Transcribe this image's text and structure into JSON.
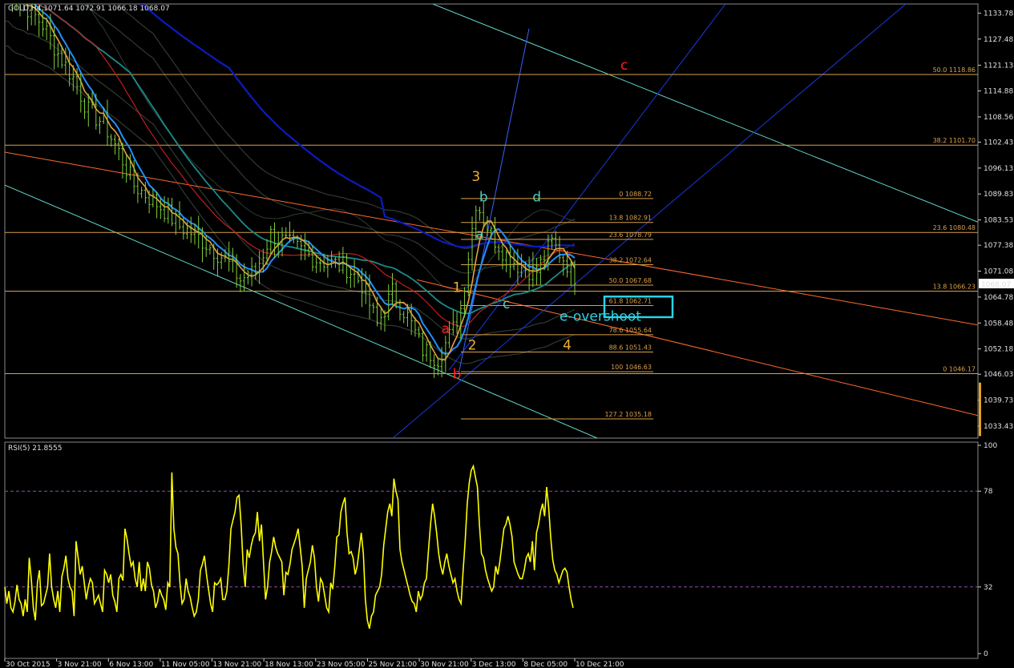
{
  "header": {
    "symbol_label": "GOLD,H4",
    "ohlc_label": "1071.64 1072.91 1066.18 1068.07",
    "current_price_label": "1068.07",
    "rsi_label": "RSI(5) 21.8555"
  },
  "colors": {
    "background": "#000000",
    "candle": "#7fd13b",
    "ma_orange": "#e8a040",
    "ma_blue": "#1e90ff",
    "ma_red": "#d02020",
    "ma_teal": "#1a8a8a",
    "ma_navy": "#0a1cc0",
    "band_gray": "#2f3a35",
    "fib_line": "#d9a04a",
    "channel_orange": "#ff6a2a",
    "channel_aqua": "#5fd7c8",
    "channel_blue": "#1838e0",
    "rsi_line": "#ffff00",
    "rsi_level": "#8a4fa8",
    "price_tag_bg": "#ffffff",
    "highlight_box": "#29d3e6"
  },
  "annotations": {
    "overshoot_label": "e-overshoot"
  },
  "chart_data": [
    {
      "type": "candlestick",
      "title": "GOLD,H4",
      "ylim": [
        1030.5,
        1136
      ],
      "y_ticks": [
        "1133.78",
        "1127.48",
        "1121.13",
        "1114.88",
        "1108.56",
        "1102.43",
        "1096.13",
        "1089.83",
        "1083.53",
        "1077.38",
        "1071.08",
        "1064.78",
        "1058.48",
        "1052.18",
        "1046.03",
        "1039.73",
        "1033.43"
      ],
      "x_ticks": [
        "30 Oct 2015",
        "3 Nov 21:00",
        "6 Nov 13:00",
        "11 Nov 05:00",
        "13 Nov 21:00",
        "18 Nov 13:00",
        "23 Nov 05:00",
        "25 Nov 21:00",
        "30 Nov 21:00",
        "3 Dec 13:00",
        "8 Dec 05:00",
        "10 Dec 21:00"
      ],
      "last_price": 1068.07,
      "price_path": [
        [
          0,
          1140
        ],
        [
          5,
          1136
        ],
        [
          10,
          1131
        ],
        [
          14,
          1124
        ],
        [
          18,
          1118
        ],
        [
          22,
          1110
        ],
        [
          26,
          1107
        ],
        [
          30,
          1100
        ],
        [
          34,
          1092
        ],
        [
          38,
          1089
        ],
        [
          42,
          1086
        ],
        [
          46,
          1082
        ],
        [
          50,
          1080
        ],
        [
          54,
          1077
        ],
        [
          58,
          1074
        ],
        [
          62,
          1069
        ],
        [
          66,
          1071
        ],
        [
          70,
          1080
        ],
        [
          74,
          1078
        ],
        [
          78,
          1076
        ],
        [
          82,
          1074
        ],
        [
          86,
          1073
        ],
        [
          90,
          1072
        ],
        [
          94,
          1068
        ],
        [
          98,
          1058
        ],
        [
          102,
          1066
        ],
        [
          106,
          1060
        ],
        [
          110,
          1052
        ],
        [
          114,
          1050
        ],
        [
          118,
          1057
        ],
        [
          120,
          1062
        ],
        [
          124,
          1088
        ],
        [
          128,
          1080
        ],
        [
          132,
          1075
        ],
        [
          136,
          1072
        ],
        [
          140,
          1071
        ],
        [
          144,
          1078
        ],
        [
          148,
          1073
        ],
        [
          150,
          1068
        ]
      ],
      "fibonacci_retracement_1": [
        {
          "label": "0 1088.72",
          "value": 1088.72
        },
        {
          "label": "13.8 1082.91",
          "value": 1082.91
        },
        {
          "label": "23.6 1078.79",
          "value": 1078.79
        },
        {
          "label": "38.2 1072.64",
          "value": 1072.64
        },
        {
          "label": "50.0 1067.68",
          "value": 1067.68
        },
        {
          "label": "61.8 1062.71",
          "value": 1062.71
        },
        {
          "label": "78.6 1055.64",
          "value": 1055.64
        },
        {
          "label": "88.6 1051.43",
          "value": 1051.43
        },
        {
          "label": "100 1046.63",
          "value": 1046.63
        },
        {
          "label": "127.2 1035.18",
          "value": 1035.18
        }
      ],
      "fibonacci_retracement_2": [
        {
          "label": "0 1046.17",
          "value": 1046.17
        },
        {
          "label": "13.8 1066.23",
          "value": 1066.23
        },
        {
          "label": "23.6 1080.48",
          "value": 1080.48
        },
        {
          "label": "38.2 1101.70",
          "value": 1101.7
        },
        {
          "label": "50.0 1118.86",
          "value": 1118.86
        }
      ],
      "wave_labels": [
        {
          "text": "3",
          "color": "#f0b030",
          "x": 124,
          "y": 1093
        },
        {
          "text": "b",
          "color": "#4fd0c0",
          "x": 126,
          "y": 1088
        },
        {
          "text": "d",
          "color": "#4fd0c0",
          "x": 140,
          "y": 1088
        },
        {
          "text": "a",
          "color": "#4fd0c0",
          "x": 125,
          "y": 1079
        },
        {
          "text": "1",
          "color": "#f0b030",
          "x": 119,
          "y": 1066
        },
        {
          "text": "c",
          "color": "#4fd0c0",
          "x": 132,
          "y": 1062
        },
        {
          "text": "a",
          "color": "#ff2020",
          "x": 116,
          "y": 1056
        },
        {
          "text": "2",
          "color": "#f0b030",
          "x": 123,
          "y": 1052
        },
        {
          "text": "4",
          "color": "#f0b030",
          "x": 148,
          "y": 1052
        },
        {
          "text": "b",
          "color": "#ff2020",
          "x": 119,
          "y": 1045
        },
        {
          "text": "c",
          "color": "#ff2020",
          "x": 163,
          "y": 1120
        }
      ]
    },
    {
      "type": "line",
      "title": "RSI(5) 21.8555",
      "ylim": [
        0,
        100
      ],
      "y_ticks": [
        "100",
        "78",
        "32",
        "0"
      ],
      "levels": [
        78,
        32
      ],
      "series": [
        {
          "name": "RSI(5)",
          "values": [
            32,
            24,
            30,
            22,
            20,
            25,
            33,
            26,
            24,
            18,
            26,
            20,
            46,
            36,
            22,
            16,
            34,
            40,
            23,
            24,
            28,
            32,
            48,
            32,
            26,
            22,
            30,
            20,
            37,
            41,
            47,
            36,
            32,
            30,
            18,
            54,
            46,
            38,
            42,
            34,
            26,
            32,
            36,
            34,
            24,
            26,
            28,
            24,
            20,
            40,
            38,
            34,
            38,
            28,
            25,
            20,
            36,
            38,
            35,
            60,
            55,
            48,
            42,
            44,
            36,
            32,
            44,
            30,
            36,
            30,
            44,
            41,
            33,
            30,
            22,
            25,
            31,
            28,
            26,
            21,
            34,
            32,
            87,
            60,
            51,
            48,
            34,
            24,
            26,
            36,
            30,
            27,
            22,
            18,
            20,
            26,
            40,
            43,
            47,
            38,
            31,
            24,
            20,
            34,
            33,
            34,
            36,
            26,
            26,
            30,
            42,
            60,
            64,
            68,
            75,
            76,
            62,
            43,
            32,
            50,
            46,
            52,
            56,
            58,
            68,
            54,
            62,
            44,
            26,
            32,
            44,
            49,
            56,
            51,
            48,
            46,
            44,
            28,
            39,
            38,
            43,
            50,
            53,
            56,
            60,
            51,
            42,
            22,
            36,
            40,
            44,
            52,
            46,
            32,
            25,
            36,
            34,
            28,
            22,
            20,
            34,
            31,
            42,
            56,
            57,
            68,
            72,
            75,
            58,
            48,
            49,
            46,
            38,
            42,
            50,
            58,
            48,
            26,
            16,
            12,
            18,
            20,
            28,
            30,
            32,
            38,
            52,
            60,
            68,
            72,
            66,
            84,
            78,
            74,
            50,
            44,
            40,
            36,
            32,
            28,
            25,
            24,
            20,
            30,
            26,
            28,
            34,
            36,
            50,
            62,
            72,
            66,
            58,
            48,
            42,
            38,
            44,
            48,
            42,
            38,
            34,
            36,
            30,
            26,
            24,
            40,
            54,
            72,
            82,
            88,
            90,
            85,
            80,
            62,
            48,
            46,
            40,
            36,
            33,
            30,
            32,
            42,
            38,
            44,
            52,
            60,
            62,
            66,
            62,
            56,
            44,
            41,
            38,
            36,
            36,
            40,
            46,
            48,
            44,
            54,
            40,
            58,
            62,
            68,
            72,
            66,
            80,
            70,
            56,
            45,
            40,
            38,
            34,
            37,
            40,
            41,
            39,
            32,
            26,
            22
          ]
        }
      ]
    }
  ]
}
